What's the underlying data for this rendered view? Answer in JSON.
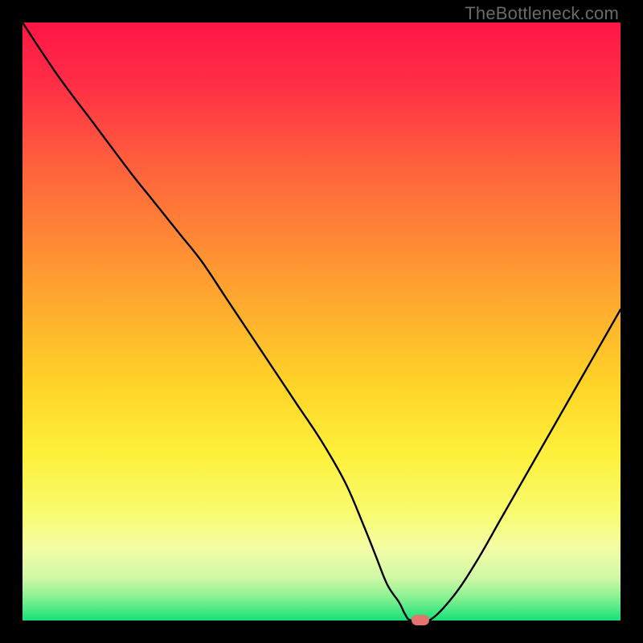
{
  "watermark": "TheBottleneck.com",
  "colors": {
    "curve": "#000000",
    "marker": "#e5746f",
    "frame": "#000000"
  },
  "chart_data": {
    "type": "line",
    "title": "",
    "xlabel": "",
    "ylabel": "",
    "xlim": [
      0,
      100
    ],
    "ylim": [
      0,
      100
    ],
    "series": [
      {
        "name": "bottleneck-curve",
        "x": [
          0,
          6,
          12,
          18,
          22,
          26,
          30,
          34,
          38,
          42,
          46,
          50,
          54,
          57,
          59,
          61,
          63,
          64,
          65,
          68,
          72,
          76,
          80,
          84,
          88,
          92,
          96,
          100
        ],
        "values": [
          100,
          91,
          83,
          75,
          70,
          65,
          60,
          54,
          48,
          42,
          36,
          30,
          23,
          16,
          11,
          6,
          3,
          1,
          0,
          0,
          4,
          10,
          17,
          24,
          31,
          38,
          45,
          52
        ]
      }
    ],
    "marker": {
      "x": 66.5,
      "y": 0
    },
    "background_gradient": {
      "stops": [
        {
          "pos": 0.0,
          "color": "#ff1646"
        },
        {
          "pos": 0.1,
          "color": "#ff2d46"
        },
        {
          "pos": 0.22,
          "color": "#ff5a3e"
        },
        {
          "pos": 0.35,
          "color": "#ff8436"
        },
        {
          "pos": 0.48,
          "color": "#ffad2e"
        },
        {
          "pos": 0.6,
          "color": "#ffd227"
        },
        {
          "pos": 0.72,
          "color": "#fdf03a"
        },
        {
          "pos": 0.82,
          "color": "#f8fb6f"
        },
        {
          "pos": 0.88,
          "color": "#f4fca6"
        },
        {
          "pos": 0.93,
          "color": "#cef8a6"
        },
        {
          "pos": 0.965,
          "color": "#7ef08f"
        },
        {
          "pos": 1.0,
          "color": "#16e07a"
        }
      ]
    }
  }
}
